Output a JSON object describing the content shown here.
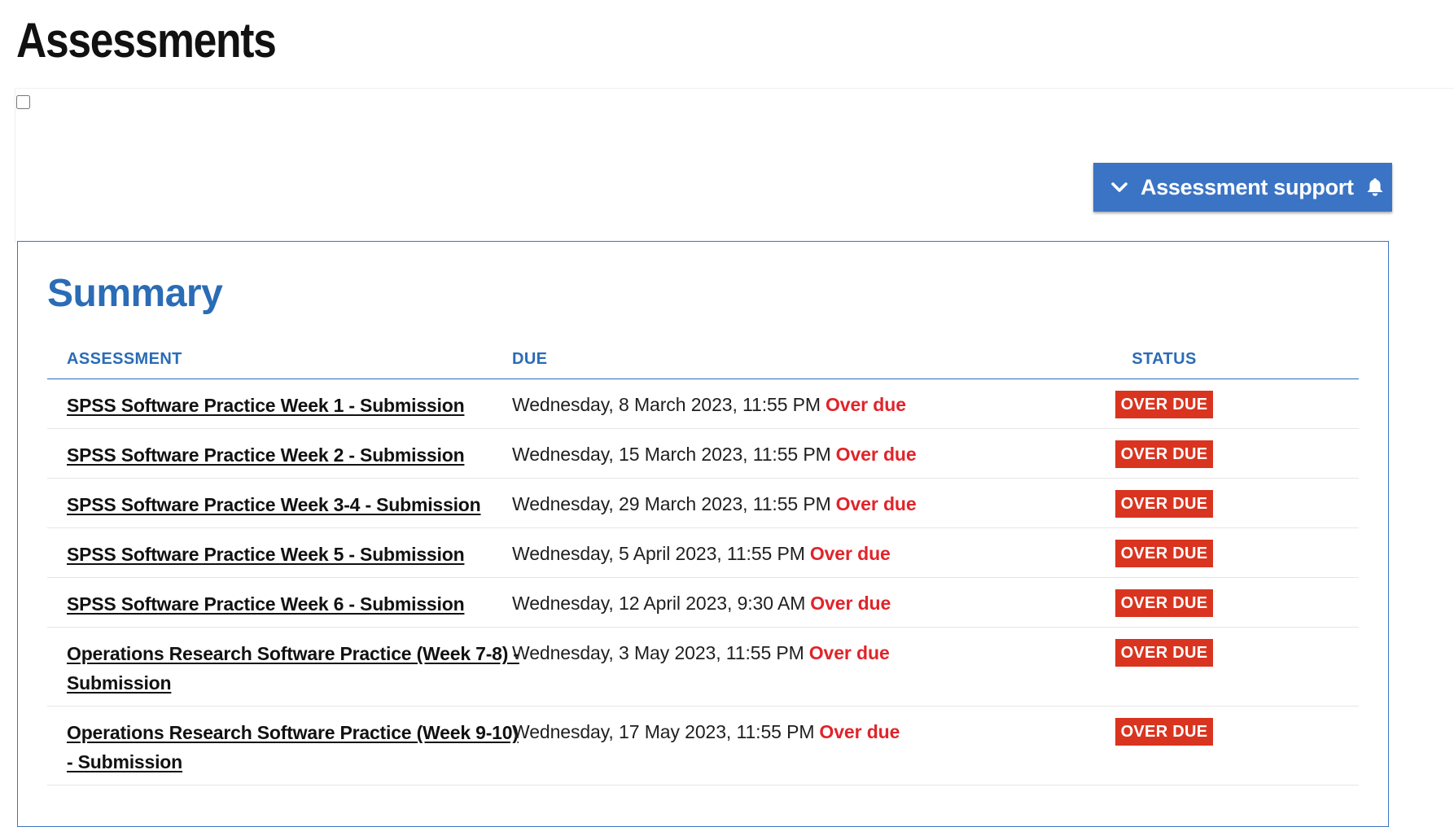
{
  "page": {
    "title": "Assessments"
  },
  "support_button": {
    "label": "Assessment support",
    "leading_icon": "chevron-down-icon",
    "trailing_icon": "bell-icon",
    "color": "#3b74c4"
  },
  "summary": {
    "heading": "Summary",
    "columns": {
      "assessment": "ASSESSMENT",
      "due": "DUE",
      "status": "STATUS"
    },
    "rows": [
      {
        "assessment": "SPSS Software Practice Week 1 - Submission",
        "due": "Wednesday, 8 March 2023, 11:55 PM",
        "due_note": "Over due",
        "status": "OVER DUE"
      },
      {
        "assessment": "SPSS Software Practice Week 2 - Submission",
        "due": "Wednesday, 15 March 2023, 11:55 PM",
        "due_note": "Over due",
        "status": "OVER DUE"
      },
      {
        "assessment": "SPSS Software Practice Week 3-4 - Submission",
        "due": "Wednesday, 29 March 2023, 11:55 PM",
        "due_note": "Over due",
        "status": "OVER DUE"
      },
      {
        "assessment": "SPSS Software Practice Week 5 - Submission",
        "due": "Wednesday, 5 April 2023, 11:55 PM",
        "due_note": "Over due",
        "status": "OVER DUE"
      },
      {
        "assessment": "SPSS Software Practice Week 6 - Submission",
        "due": "Wednesday, 12 April 2023, 9:30 AM",
        "due_note": "Over due",
        "status": "OVER DUE"
      },
      {
        "assessment": "Operations Research Software Practice (Week 7-8) - Submission",
        "due": "Wednesday, 3 May 2023, 11:55 PM",
        "due_note": "Over due",
        "status": "OVER DUE"
      },
      {
        "assessment": "Operations Research Software Practice (Week 9-10) - Submission",
        "due": "Wednesday, 17 May 2023, 11:55 PM",
        "due_note": "Over due",
        "status": "OVER DUE"
      }
    ]
  },
  "colors": {
    "accent": "#2a6cb6",
    "overdue_text": "#e0242a",
    "overdue_badge": "#d9341f"
  }
}
